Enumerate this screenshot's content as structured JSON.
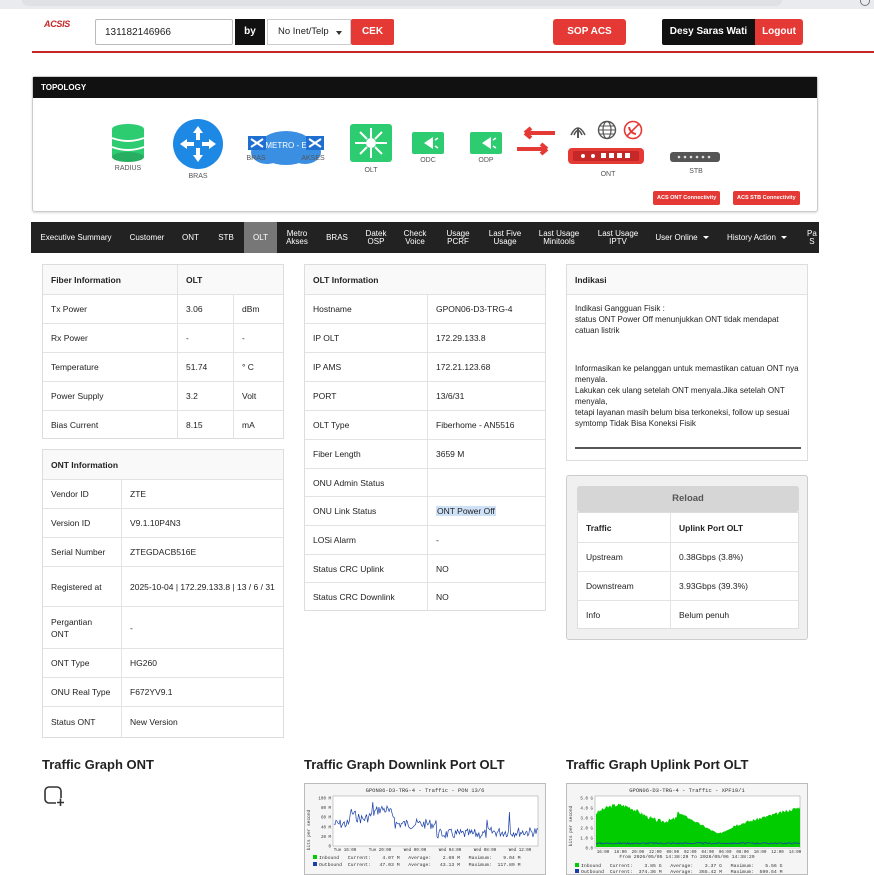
{
  "header": {
    "logo": "ACSIS",
    "phone_value": "131182146966",
    "by_label": "by",
    "select_value": "No Inet/Telp",
    "cek_label": "CEK",
    "sop_label": "SOP ACS",
    "user_name": "Desy Saras Wati",
    "logout_label": "Logout"
  },
  "topology": {
    "title": "TOPOLOGY",
    "nodes": {
      "radius": "RADIUS",
      "bras": "BRAS",
      "bras2": "BRAS",
      "metro": "METRO - E",
      "akses": "AKSES",
      "olt": "OLT",
      "odc": "ODC",
      "odp": "ODP",
      "ont": "ONT",
      "stb": "STB"
    },
    "acs_ont": "ACS ONT Connectivity",
    "acs_stb": "ACS STB Connectivity"
  },
  "tabs": [
    "Executive Summary",
    "Customer",
    "ONT",
    "STB",
    "OLT",
    "Metro\nAkses",
    "BRAS",
    "Datek\nOSP",
    "Check\nVoice",
    "Usage\nPCRF",
    "Last Five\nUsage",
    "Last Usage\nMinitools",
    "Last Usage\nIPTV",
    "User Online",
    "History Action",
    "Pa\nS"
  ],
  "fiber": {
    "header": [
      "Fiber Information",
      "OLT"
    ],
    "rows": [
      [
        "Tx Power",
        "3.06",
        "dBm"
      ],
      [
        "Rx Power",
        "-",
        "-"
      ],
      [
        "Temperature",
        "51.74",
        "° C"
      ],
      [
        "Power Supply",
        "3.2",
        "Volt"
      ],
      [
        "Bias Current",
        "8.15",
        "mA"
      ]
    ]
  },
  "ont_info": {
    "header": "ONT Information",
    "rows": [
      [
        "Vendor ID",
        "ZTE"
      ],
      [
        "Version ID",
        "V9.1.10P4N3"
      ],
      [
        "Serial Number",
        "ZTEGDACB516E"
      ],
      [
        "Registered at",
        "2025-10-04 | 172.29.133.8 | 13 / 6 / 31"
      ],
      [
        "Pergantian ONT",
        "-"
      ],
      [
        "ONT Type",
        "HG260"
      ],
      [
        "ONU Real Type",
        "F672YV9.1"
      ],
      [
        "Status ONT",
        "New Version"
      ]
    ]
  },
  "olt_info": {
    "header": "OLT Information",
    "rows": [
      [
        "Hostname",
        "GPON06-D3-TRG-4"
      ],
      [
        "IP OLT",
        "172.29.133.8"
      ],
      [
        "IP AMS",
        "172.21.123.68"
      ],
      [
        "PORT",
        "13/6/31"
      ],
      [
        "OLT Type",
        "Fiberhome - AN5516"
      ],
      [
        "Fiber Length",
        "3659 M"
      ],
      [
        "ONU Admin Status",
        ""
      ],
      [
        "ONU Link Status",
        "ONT Power Off"
      ],
      [
        "LOSi Alarm",
        "-"
      ],
      [
        "Status CRC Uplink",
        "NO"
      ],
      [
        "Status CRC Downlink",
        "NO"
      ]
    ]
  },
  "indikasi": {
    "header": "Indikasi",
    "p1": "Indikasi Gangguan Fisik :",
    "p2": "status ONT Power Off menunjukkan ONT tidak mendapat catuan listrik",
    "p3": "Informasikan ke pelanggan untuk memastikan catuan ONT nya menyala.",
    "p4": "Lakukan cek ulang setelah ONT menyala.Jika setelah ONT menyala,",
    "p5": "tetapi layanan masih belum bisa terkoneksi, follow up sesuai symtomp Tidak Bisa Koneksi Fisik"
  },
  "traffic": {
    "reload": "Reload",
    "header": [
      "Traffic",
      "Uplink Port OLT"
    ],
    "rows": [
      [
        "Upstream",
        "0.38Gbps (3.8%)"
      ],
      [
        "Downstream",
        "3.93Gbps (39.3%)"
      ],
      [
        "Info",
        "Belum penuh"
      ]
    ]
  },
  "graphs": {
    "ont_title": "Traffic Graph ONT",
    "downlink_title": "Traffic Graph Downlink Port OLT",
    "uplink_title": "Traffic Graph Uplink Port OLT",
    "downlink_img_title": "GPON06-D3-TRG-4 - Traffic - PON 13/6",
    "uplink_img_title": "GPON06-D3-TRG-4 - Traffic - XPF19/1",
    "downlink_axis_label": "bits per second",
    "uplink_axis_label": "bits per second",
    "downlink_yticks": [
      "100 M",
      "80 M",
      "60 M",
      "40 M",
      "20 M",
      "0"
    ],
    "uplink_yticks": [
      "5.0 G",
      "4.0 G",
      "3.0 G",
      "2.0 G",
      "1.0 G",
      "0.0"
    ],
    "downlink_xticks": [
      "Tue 16:00",
      "Tue 20:00",
      "Wed 00:00",
      "Wed 04:00",
      "Wed 08:00",
      "Wed 12:00"
    ],
    "uplink_xticks": [
      "16:00",
      "18:00",
      "20:00",
      "22:00",
      "00:00",
      "02:00",
      "04:00",
      "06:00",
      "08:00",
      "10:00",
      "12:00",
      "14:00"
    ],
    "uplink_range": "From 2026/05/05 14:38:29 To 2026/05/06 14:38:29",
    "downlink_inbound": "Inbound   Current:    4.07 M   Average:    2.69 M   Maximum:    9.04 M",
    "downlink_outbound": "Outbound  Current:   47.03 M   Average:   43.13 M   Maximum:  117.89 M",
    "uplink_inbound": "Inbound   Current:    3.85 G   Average:    3.37 G   Maximum:    5.56 G",
    "uplink_outbound": "Outbound  Current:  374.36 M   Average:  365.42 M   Maximum:  599.54 M"
  },
  "colors": {
    "accent_red": "#e53935",
    "dark": "#111111",
    "node_blue": "#1e88e5",
    "node_green": "#2ecc71",
    "graph_green": "#00cc00",
    "graph_blue": "#1a3fa8"
  }
}
